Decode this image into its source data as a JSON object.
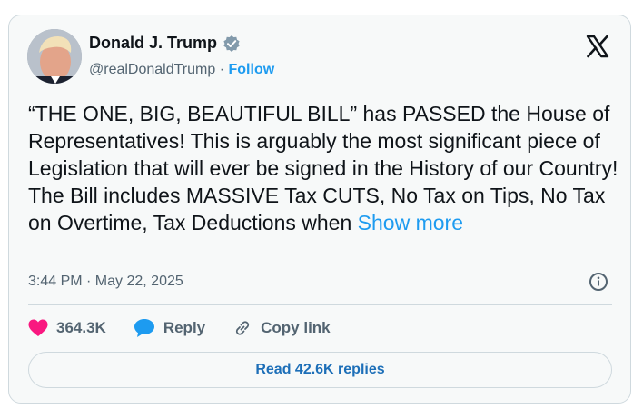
{
  "author": {
    "name": "Donald J. Trump",
    "handle": "@realDonaldTrump",
    "separator": "·",
    "follow_label": "Follow"
  },
  "tweet": {
    "text": "“THE ONE, BIG, BEAUTIFUL BILL” has PASSED the House of Representatives! This is arguably the most significant piece of Legislation that will ever be signed in the History of our Country! The Bill includes MASSIVE Tax CUTS, No Tax on Tips, No Tax on Overtime, Tax Deductions when ",
    "show_more": "Show more",
    "timestamp": "3:44 PM · May 22, 2025"
  },
  "actions": {
    "likes": "364.3K",
    "reply": "Reply",
    "copy_link": "Copy link"
  },
  "replies_button": "Read 42.6K replies",
  "colors": {
    "accent": "#1d9bf0",
    "like": "#f91880",
    "verified": "#829aab"
  },
  "icons": [
    "x-logo-icon",
    "verified-badge-icon",
    "info-icon",
    "heart-icon",
    "reply-bubble-icon",
    "link-icon"
  ]
}
